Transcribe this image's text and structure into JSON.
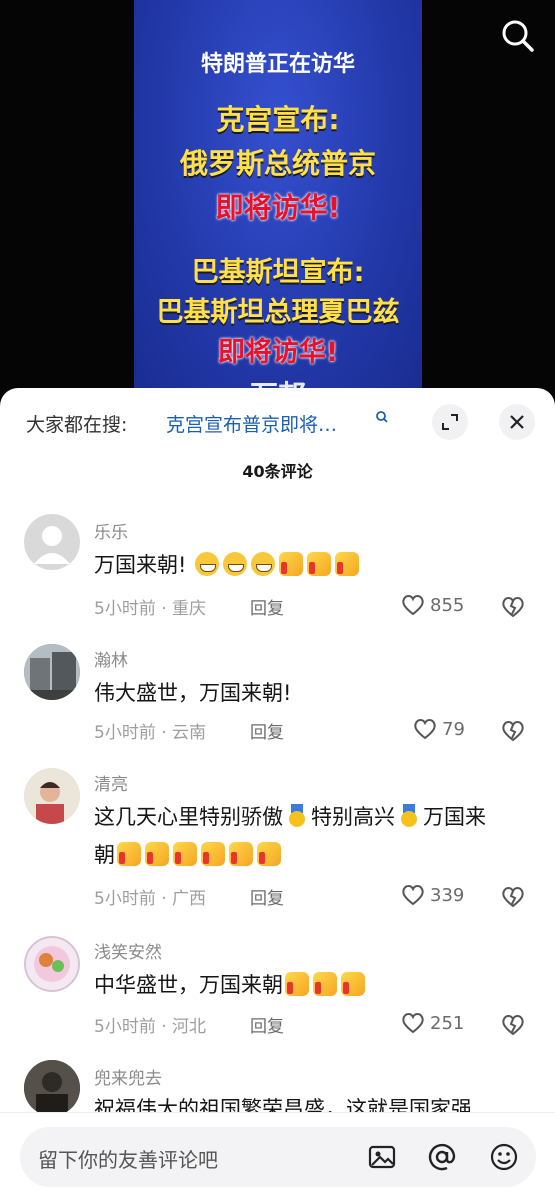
{
  "video": {
    "lines": [
      "特朗普正在访华",
      "克宫宣布:",
      "俄罗斯总统普京",
      "即将访华!",
      "巴基斯坦宣布:",
      "巴基斯坦总理夏巴兹",
      "即将访华!",
      "万邦"
    ],
    "icon": "search-icon"
  },
  "comments_panel": {
    "hot_search_label": "大家都在搜:",
    "hot_search_query": "克宫宣布普京即将…",
    "comment_count": "40条评论",
    "comments": [
      {
        "user": "乐乐",
        "text": "万国来朝!",
        "emojis": [
          "grin",
          "grin",
          "grin",
          "thumbs-up",
          "thumbs-up",
          "thumbs-up"
        ],
        "time": "5小时前",
        "location": "重庆",
        "reply": "回复",
        "likes": "855"
      },
      {
        "user": "瀚林",
        "text": "伟大盛世，万国来朝!",
        "emojis": [],
        "time": "5小时前",
        "location": "云南",
        "reply": "回复",
        "likes": "79"
      },
      {
        "user": "清亮",
        "text_parts": [
          "这几天心里特别骄傲",
          "特别高兴",
          "万国来",
          "朝"
        ],
        "emojis": [
          "medal",
          "medal",
          "thumbs-up",
          "thumbs-up",
          "thumbs-up",
          "thumbs-up",
          "thumbs-up",
          "thumbs-up"
        ],
        "time": "5小时前",
        "location": "广西",
        "reply": "回复",
        "likes": "339"
      },
      {
        "user": "浅笑安然",
        "text": "中华盛世，万国来朝",
        "emojis": [
          "thumbs-up",
          "thumbs-up",
          "thumbs-up"
        ],
        "time": "5小时前",
        "location": "河北",
        "reply": "回复",
        "likes": "251"
      },
      {
        "user": "兜来兜去",
        "text": "祝福伟大的祖国繁荣昌盛，这就是国家强"
      }
    ],
    "separator": "·"
  },
  "input": {
    "placeholder": "留下你的友善评论吧",
    "icons": [
      "image-icon",
      "at-icon",
      "emoji-icon"
    ]
  },
  "colors": {
    "accent_link": "#1a5fb4",
    "video_bg": "#2a3fb5",
    "caption_yellow": "#ffe04a",
    "caption_red": "#e8102a"
  }
}
